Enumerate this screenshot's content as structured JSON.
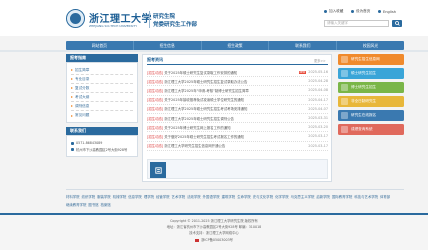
{
  "header": {
    "logo_cn": "浙江理工大学",
    "logo_en": "ZHEJIANG SCI-TECH UNIVERSITY",
    "dept_line1": "研究生院",
    "dept_line2": "党委研究生工作部",
    "links": [
      "加入收藏",
      "设为首页",
      "English"
    ],
    "search_placeholder": "请输入关键字"
  },
  "nav": {
    "items": [
      "网站首页",
      "招生信息",
      "招生政策",
      "联系我们",
      "校园风光"
    ]
  },
  "sidebar": {
    "title": "报考指南",
    "items": [
      "招生简章",
      "专业目录",
      "复试分数",
      "考试大纲",
      "调剂信息",
      "常见问题"
    ],
    "contact_title": "联系我们",
    "phone": "0571-86843089",
    "address": "杭州市下沙高教园区2号大街928号"
  },
  "main": {
    "title": "报考资讯",
    "more": "更多>>",
    "news": [
      {
        "badge": "[招生动态]",
        "title": "关于2025年硕士研究生复试录取工作安排的通知",
        "new": "NEW",
        "date": "2025-05-16"
      },
      {
        "badge": "[招生动态]",
        "title": "浙江理工大学2025年硕士研究生招生复试录取办法公告",
        "new": "",
        "date": "2025-04-28"
      },
      {
        "badge": "[招生动态]",
        "title": "浙江理工大学2025年“申请-考核”制博士研究生招生简章",
        "new": "",
        "date": "2025-04-08"
      },
      {
        "badge": "[招生动态]",
        "title": "关于2025年接收推荐免试攻读硕士学位研究生的通知",
        "new": "",
        "date": "2025-04-17"
      },
      {
        "badge": "[招生动态]",
        "title": "浙江理工大学2025年硕士研究生招生考试考场安排通知",
        "new": "",
        "date": "2025-04-07"
      },
      {
        "badge": "[招生动态]",
        "title": "浙江理工大学2025年硕士研究生招生调剂公告",
        "new": "",
        "date": "2025-03-31"
      },
      {
        "badge": "[招生动态]",
        "title": "关于2025年博士研究生网上报名工作的通知",
        "new": "",
        "date": "2025-03-20"
      },
      {
        "badge": "[招生动态]",
        "title": "关于做好2025年硕士研究生招生考试报名工作的通知",
        "new": "",
        "date": "2025-03-17"
      },
      {
        "badge": "[招生动态]",
        "title": "浙江理工大学研究生招生信息网开通公告",
        "new": "",
        "date": "2025-03-17"
      }
    ]
  },
  "right_buttons": [
    {
      "label": "研究生招生信息网",
      "color": "#f08a2c"
    },
    {
      "label": "硕士研究生招生",
      "color": "#3aa5d8"
    },
    {
      "label": "博士研究生招生",
      "color": "#7ab648"
    },
    {
      "label": "非全日制研究生",
      "color": "#e8b73a"
    },
    {
      "label": "研究生在线报名",
      "color": "#3a79b0"
    },
    {
      "label": "成绩查询系统",
      "color": "#e0695c"
    }
  ],
  "footer_links": [
    "材料学院",
    "纺织学院",
    "服装学院",
    "机械学院",
    "信息学院",
    "理学院",
    "经管学院",
    "艺术学院",
    "法政学院",
    "外国语学院",
    "建筑学院",
    "生命学院",
    "史与文化学院",
    "化学学院",
    "马克思主义学院",
    "启新学院",
    "国际教育学院",
    "科技与艺术学院",
    "体育部",
    "继续教育学院",
    "图书馆",
    "档案馆"
  ],
  "footer": {
    "line1": "Copyright © 2011-2025 浙江理工大学研究生院 版权所有",
    "line2": "地址：浙江省杭州市下沙高教园区2号大街928号   邮编：310018",
    "line3": "技术支持：浙江理工大学网络中心",
    "line4": "浙ICP备05003003号"
  }
}
